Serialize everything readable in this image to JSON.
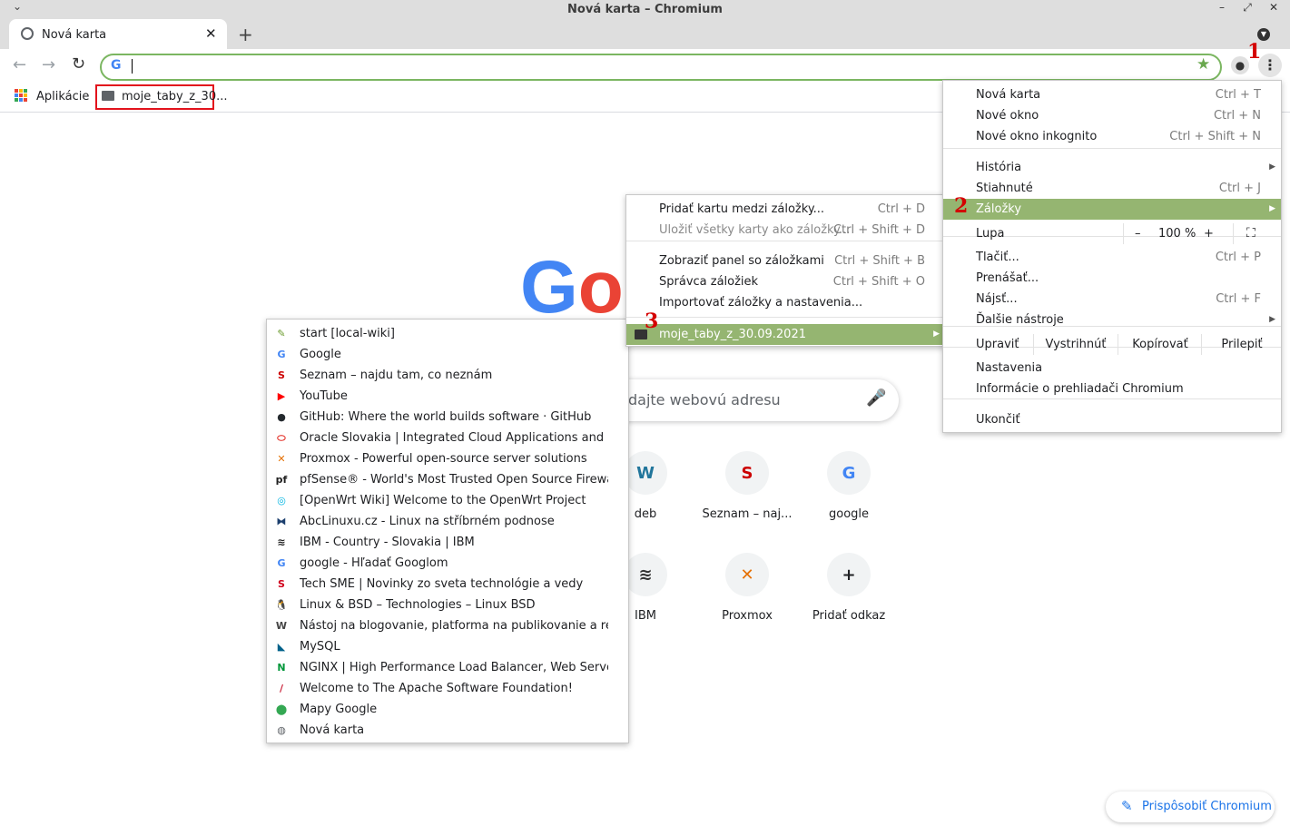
{
  "window": {
    "title": "Nová karta – Chromium"
  },
  "tab": {
    "title": "Nová karta"
  },
  "bookmarks_bar": {
    "apps_label": "Aplikácie",
    "folder_label": "moje_taby_z_30..."
  },
  "annotations": {
    "one": "1",
    "two": "2",
    "three": "3"
  },
  "main_menu": {
    "items": [
      {
        "label": "Nová karta",
        "shortcut": "Ctrl + T"
      },
      {
        "label": "Nové okno",
        "shortcut": "Ctrl + N"
      },
      {
        "label": "Nové okno inkognito",
        "shortcut": "Ctrl + Shift + N"
      },
      {
        "label": "História",
        "shortcut": ""
      },
      {
        "label": "Stiahnuté",
        "shortcut": "Ctrl + J"
      },
      {
        "label": "Záložky",
        "shortcut": ""
      },
      {
        "label": "Lupa",
        "shortcut": ""
      },
      {
        "label": "Tlačiť...",
        "shortcut": "Ctrl + P"
      },
      {
        "label": "Prenášať...",
        "shortcut": ""
      },
      {
        "label": "Nájsť...",
        "shortcut": "Ctrl + F"
      },
      {
        "label": "Ďalšie nástroje",
        "shortcut": ""
      },
      {
        "label": "Nastavenia",
        "shortcut": ""
      },
      {
        "label": "Informácie o prehliadači Chromium",
        "shortcut": ""
      },
      {
        "label": "Ukončiť",
        "shortcut": ""
      }
    ],
    "zoom": {
      "minus": "–",
      "value": "100 %",
      "plus": "+"
    },
    "edit": {
      "label": "Upraviť",
      "cut": "Vystrihnúť",
      "copy": "Kopírovať",
      "paste": "Prilepiť"
    }
  },
  "bookmarks_submenu": {
    "items": [
      {
        "label": "Pridať kartu medzi záložky...",
        "shortcut": "Ctrl + D"
      },
      {
        "label": "Uložiť všetky karty ako záložky...",
        "shortcut": "Ctrl + Shift + D"
      },
      {
        "label": "Zobraziť panel so záložkami",
        "shortcut": "Ctrl + Shift + B"
      },
      {
        "label": "Správca záložiek",
        "shortcut": "Ctrl + Shift + O"
      },
      {
        "label": "Importovať záložky a nastavenia...",
        "shortcut": ""
      },
      {
        "label": "moje_taby_z_30.09.2021",
        "shortcut": ""
      }
    ]
  },
  "folder_items": [
    {
      "label": "start [local-wiki]",
      "icon": "wiki-icon",
      "glyph": "✎",
      "color": "#6a9a2c"
    },
    {
      "label": "Google",
      "icon": "google-icon",
      "glyph": "G",
      "color": "#4285f4"
    },
    {
      "label": "Seznam – najdu tam, co neznám",
      "icon": "seznam-icon",
      "glyph": "S",
      "color": "#cc0000"
    },
    {
      "label": "YouTube",
      "icon": "youtube-icon",
      "glyph": "▶",
      "color": "#ff0000"
    },
    {
      "label": "GitHub: Where the world builds software · GitHub",
      "icon": "github-icon",
      "glyph": "●",
      "color": "#24292e"
    },
    {
      "label": "Oracle Slovakia | Integrated Cloud Applications and Platform Services",
      "icon": "oracle-icon",
      "glyph": "⬭",
      "color": "#e2231a"
    },
    {
      "label": "Proxmox - Powerful open-source server solutions",
      "icon": "proxmox-icon",
      "glyph": "✕",
      "color": "#e57000"
    },
    {
      "label": "pfSense® - World's Most Trusted Open Source Firewall",
      "icon": "pfsense-icon",
      "glyph": "pf",
      "color": "#212121"
    },
    {
      "label": "[OpenWrt Wiki] Welcome to the OpenWrt Project",
      "icon": "openwrt-icon",
      "glyph": "◎",
      "color": "#00b5e2"
    },
    {
      "label": "AbcLinuxu.cz - Linux na stříbrném podnose",
      "icon": "abclinuxu-icon",
      "glyph": "⧓",
      "color": "#1c3f6e"
    },
    {
      "label": "IBM - Country - Slovakia | IBM",
      "icon": "ibm-icon",
      "glyph": "≋",
      "color": "#1f1f1f"
    },
    {
      "label": "google - Hľadať Googlom",
      "icon": "google-icon",
      "glyph": "G",
      "color": "#4285f4"
    },
    {
      "label": "Tech SME | Novinky zo sveta technológie a vedy",
      "icon": "sme-icon",
      "glyph": "S",
      "color": "#d0021b"
    },
    {
      "label": "Linux & BSD – Technologies – Linux BSD",
      "icon": "tux-icon",
      "glyph": "🐧",
      "color": "#333333"
    },
    {
      "label": "Nástoj na blogovanie, platforma na publikovanie a redakčný systém",
      "icon": "wordpress-icon",
      "glyph": "W",
      "color": "#464646"
    },
    {
      "label": "MySQL",
      "icon": "mysql-icon",
      "glyph": "◣",
      "color": "#00618a"
    },
    {
      "label": "NGINX | High Performance Load Balancer, Web Server, & Reverse Proxy",
      "icon": "nginx-icon",
      "glyph": "N",
      "color": "#009639"
    },
    {
      "label": "Welcome to The Apache Software Foundation!",
      "icon": "apache-icon",
      "glyph": "/",
      "color": "#c92037"
    },
    {
      "label": "Mapy Google",
      "icon": "maps-icon",
      "glyph": "⬤",
      "color": "#34a853"
    },
    {
      "label": "Nová karta",
      "icon": "globe-icon",
      "glyph": "◍",
      "color": "#5f6368"
    }
  ],
  "ntp": {
    "logo_partial": "Go",
    "search_placeholder": "dajte webovú adresu",
    "shortcuts": [
      {
        "name": "deb",
        "glyph": "W",
        "color": "#21759b"
      },
      {
        "name": "Seznam – naj...",
        "glyph": "S",
        "color": "#cc0000"
      },
      {
        "name": "google",
        "glyph": "G",
        "color": "#4285f4"
      },
      {
        "name": "IBM",
        "glyph": "≋",
        "color": "#333333"
      },
      {
        "name": "Proxmox",
        "glyph": "✕",
        "color": "#e57000"
      },
      {
        "name": "Pridať odkaz",
        "glyph": "+",
        "color": "#202124"
      }
    ],
    "customize_label": "Prispôsobiť Chromium"
  }
}
